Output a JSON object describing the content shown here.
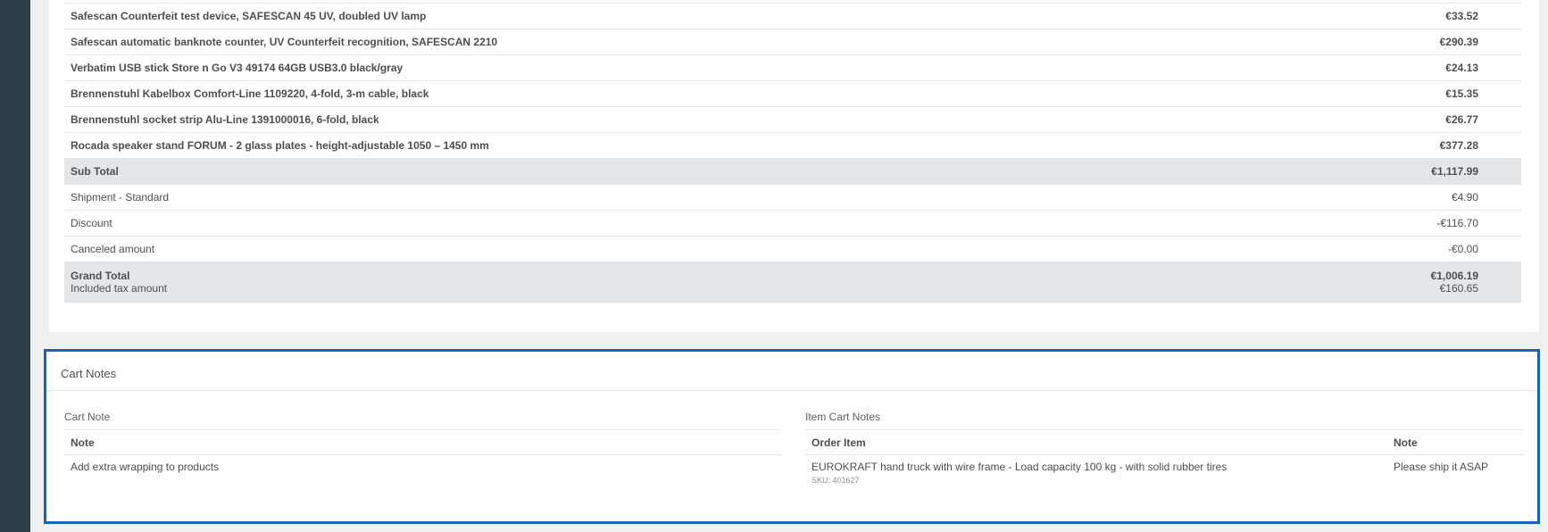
{
  "order_lines": [
    {
      "name": "Safescan Counterfeit test device, SAFESCAN 45 UV, doubled UV lamp",
      "price": "€33.52"
    },
    {
      "name": "Safescan automatic banknote counter, UV Counterfeit recognition, SAFESCAN 2210",
      "price": "€290.39"
    },
    {
      "name": "Verbatim USB stick Store n Go V3 49174 64GB USB3.0 black/gray",
      "price": "€24.13"
    },
    {
      "name": "Brennenstuhl Kabelbox Comfort-Line 1109220, 4-fold, 3-m cable, black",
      "price": "€15.35"
    },
    {
      "name": "Brennenstuhl socket strip Alu-Line 1391000016, 6-fold, black",
      "price": "€26.77"
    },
    {
      "name": "Rocada speaker stand FORUM - 2 glass plates - height-adjustable 1050 – 1450 mm",
      "price": "€377.28"
    }
  ],
  "totals": {
    "subtotal_label": "Sub Total",
    "subtotal_value": "€1,117.99",
    "shipment_label": "Shipment - Standard",
    "shipment_value": "€4.90",
    "discount_label": "Discount",
    "discount_value": "-€116.70",
    "canceled_label": "Canceled amount",
    "canceled_value": "-€0.00",
    "grand_label": "Grand Total",
    "grand_value": "€1,006.19",
    "tax_label": "Included tax amount",
    "tax_value": "€160.65"
  },
  "cart_notes": {
    "title": "Cart Notes",
    "cart_note_label": "Cart Note",
    "cart_note_header": "Note",
    "cart_note_text": "Add extra wrapping to products",
    "item_notes_label": "Item Cart Notes",
    "order_item_header": "Order Item",
    "note_header": "Note",
    "item_name": "EUROKRAFT hand truck with wire frame - Load capacity 100 kg - with solid rubber tires",
    "item_sku": "SKU: 401627",
    "item_note": "Please ship it ASAP"
  },
  "colors": {
    "rail": "#2e3d4b",
    "highlight_border": "#1565b0",
    "shaded_row": "#e4e7ea"
  }
}
